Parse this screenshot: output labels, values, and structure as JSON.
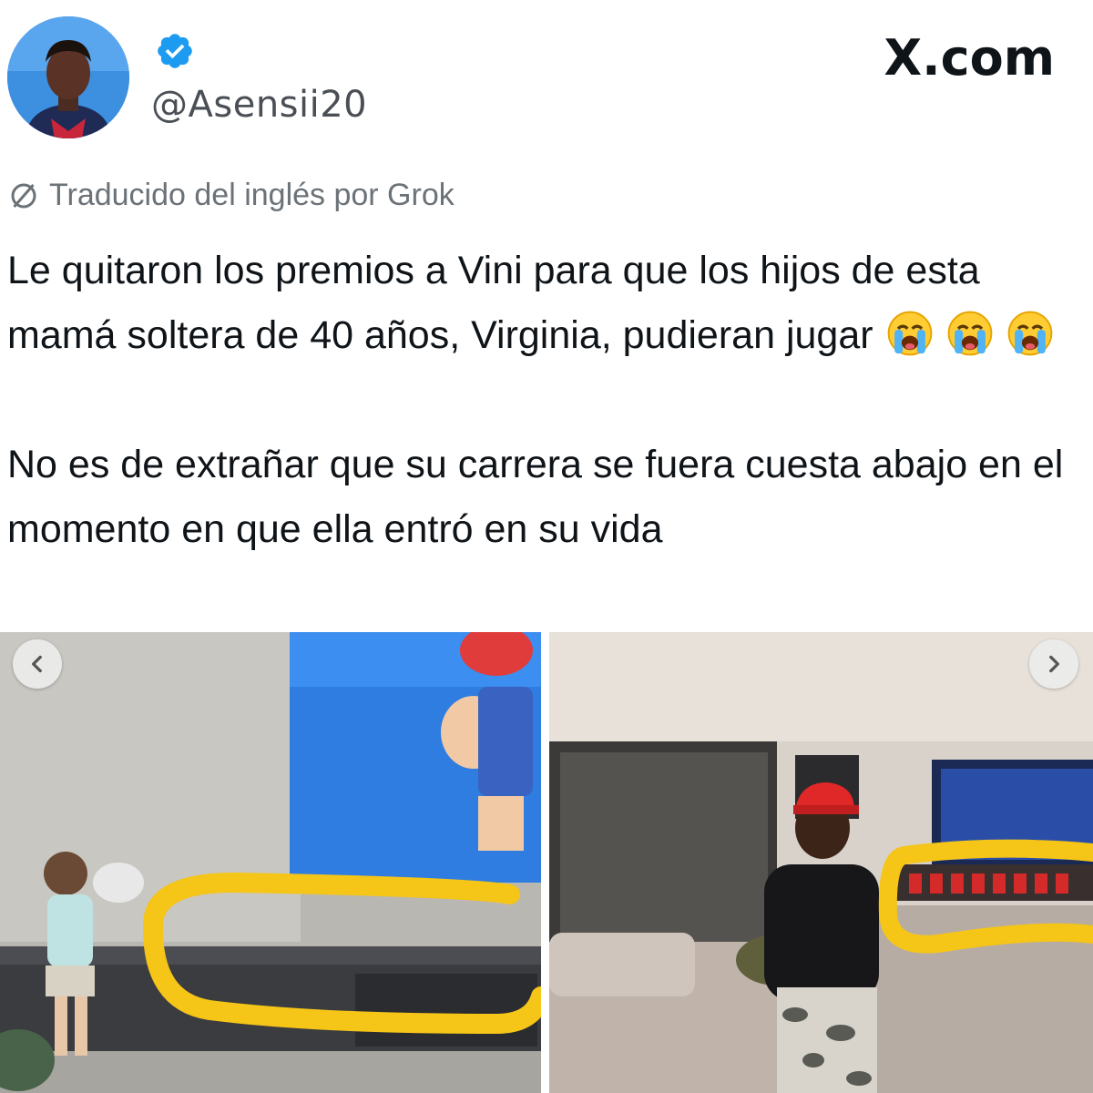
{
  "header": {
    "handle": "@Asensii20",
    "brand": "X.com"
  },
  "translation_note": "Traducido del inglés por Grok",
  "tweet": {
    "paragraph_1": "Le quitaron los premios a Vini para que los hijos de esta mamá soltera de 40 años, Virginia, pudieran jugar",
    "paragraph_2": "No es de extrañar que su carrera se fuera cuesta abajo en el momento en que ella entró en su vida"
  },
  "emoji": [
    "loudly-crying-face",
    "loudly-crying-face",
    "loudly-crying-face"
  ],
  "media": [
    {
      "id": "photo-child-tv",
      "shows": "child playing by TV with highlighted empty shelf"
    },
    {
      "id": "photo-man-cap",
      "shows": "man in red cap in living room with highlighted trophies"
    }
  ],
  "colors": {
    "accent": "#1d9bf0",
    "highlight": "#f5c518",
    "muted": "#6b7278"
  },
  "icons": {
    "verified": "verified-badge-icon",
    "translate": "translate-icon",
    "prev": "chevron-left-icon",
    "next": "chevron-right-icon"
  }
}
